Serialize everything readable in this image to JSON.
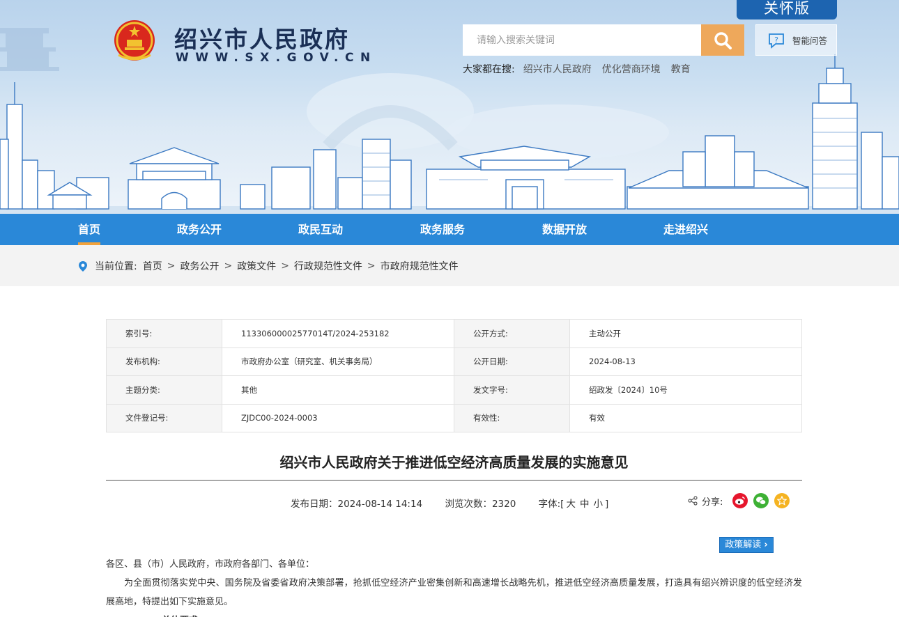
{
  "header": {
    "care_label": "关怀版",
    "site_title": "绍兴市人民政府",
    "site_url": "WWW.SX.GOV.CN",
    "search_placeholder": "请输入搜索关键词",
    "ai_label": "智能问答",
    "hot_label": "大家都在搜:",
    "hot_links": [
      "绍兴市人民政府",
      "优化营商环境",
      "教育"
    ]
  },
  "nav": {
    "items": [
      "首页",
      "政务公开",
      "政民互动",
      "政务服务",
      "数据开放",
      "走进绍兴"
    ],
    "active_index": 0
  },
  "breadcrumb": {
    "label": "当前位置:",
    "items": [
      "首页",
      "政务公开",
      "政策文件",
      "行政规范性文件",
      "市政府规范性文件"
    ],
    "separator": ">"
  },
  "info_table": {
    "rows": [
      {
        "k1": "索引号:",
        "v1": "11330600002577014T/2024-253182",
        "k2": "公开方式:",
        "v2": "主动公开"
      },
      {
        "k1": "发布机构:",
        "v1": "市政府办公室（研究室、机关事务局）",
        "k2": "公开日期:",
        "v2": "2024-08-13"
      },
      {
        "k1": "主题分类:",
        "v1": "其他",
        "k2": "发文字号:",
        "v2": "绍政发〔2024〕10号"
      },
      {
        "k1": "文件登记号:",
        "v1": "ZJDC00-2024-0003",
        "k2": "有效性:",
        "v2": "有效"
      }
    ]
  },
  "article": {
    "title": "绍兴市人民政府关于推进低空经济高质量发展的实施意见",
    "publish": "发布日期：2024-08-14 14:14",
    "views": "浏览次数：2320",
    "font_label": "字体:[",
    "font_large": "大",
    "font_mid": "中",
    "font_small": "小",
    "font_close": "]",
    "share_label": "分享:",
    "policy_btn": "政策解读",
    "salutation": "各区、县（市）人民政府，市政府各部门、各单位：",
    "paragraph1": "为全面贯彻落实党中央、国务院及省委省政府决策部署，抢抓低空经济产业密集创新和高速增长战略先机，推进低空经济高质量发展，打造具有绍兴辨识度的低空经济发展高地，特提出如下实施意见。",
    "section1": "一、总体要求"
  },
  "colors": {
    "nav_bg": "#2a88d8",
    "nav_active": "#f2a23b",
    "search_btn": "#eea85b",
    "care_bg": "#1d64b0",
    "weibo": "#e6162d",
    "wechat": "#3eb135",
    "favorite": "#f5b321"
  }
}
